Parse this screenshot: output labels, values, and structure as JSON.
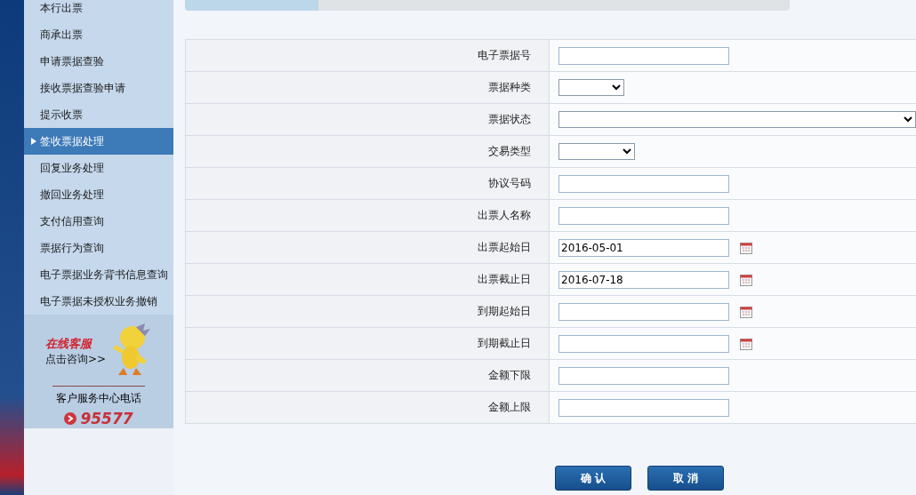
{
  "sidebar": {
    "items": [
      {
        "label": "本行出票",
        "selected": false
      },
      {
        "label": "商承出票",
        "selected": false
      },
      {
        "label": "申请票据查验",
        "selected": false
      },
      {
        "label": "接收票据查验申请",
        "selected": false
      },
      {
        "label": "提示收票",
        "selected": false
      },
      {
        "label": "签收票据处理",
        "selected": true
      },
      {
        "label": "回复业务处理",
        "selected": false
      },
      {
        "label": "撤回业务处理",
        "selected": false
      },
      {
        "label": "支付信用查询",
        "selected": false
      },
      {
        "label": "票据行为查询",
        "selected": false
      },
      {
        "label": "电子票据业务背书信息查询",
        "selected": false
      },
      {
        "label": "电子票据未授权业务撤销",
        "selected": false
      }
    ],
    "service": {
      "title": "在线客服",
      "link": "点击咨询>>",
      "hotline_label": "客户服务中心电话",
      "hotline": "95577"
    }
  },
  "form": {
    "fields": [
      {
        "label": "电子票据号",
        "kind": "text"
      },
      {
        "label": "票据种类",
        "kind": "select"
      },
      {
        "label": "票据状态",
        "kind": "select"
      },
      {
        "label": "交易类型",
        "kind": "select"
      },
      {
        "label": "协议号码",
        "kind": "text"
      },
      {
        "label": "出票人名称",
        "kind": "text"
      },
      {
        "label": "出票起始日",
        "kind": "date",
        "value": "2016-05-01"
      },
      {
        "label": "出票截止日",
        "kind": "date",
        "value": "2016-07-18"
      },
      {
        "label": "到期起始日",
        "kind": "date"
      },
      {
        "label": "到期截止日",
        "kind": "date"
      },
      {
        "label": "金额下限",
        "kind": "text"
      },
      {
        "label": "金额上限",
        "kind": "text"
      }
    ]
  },
  "buttons": [
    "确 认",
    "取 消"
  ]
}
